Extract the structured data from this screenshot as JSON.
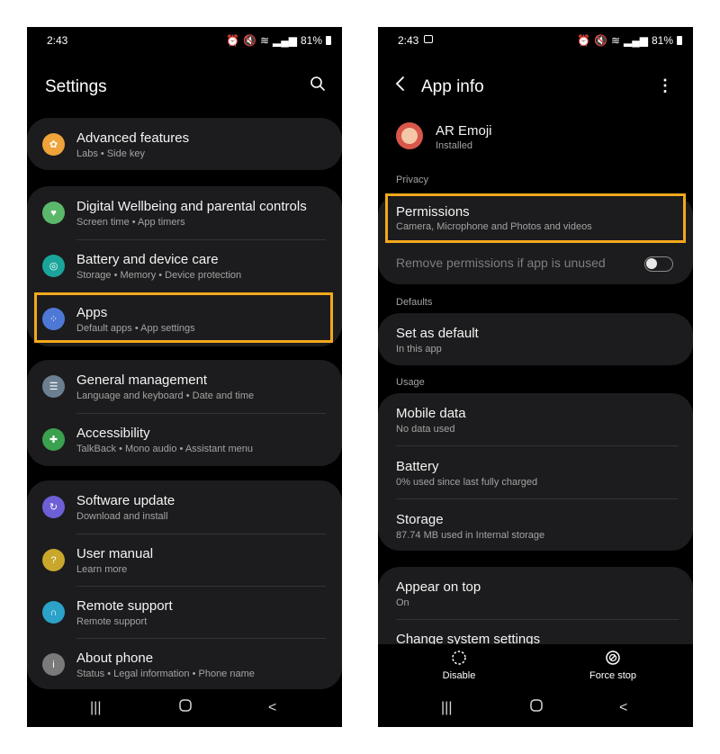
{
  "left": {
    "status_time": "2:43",
    "status_battery": "81%",
    "title": "Settings",
    "groups": [
      {
        "items": [
          {
            "label": "Advanced features",
            "sub": "Labs  •  Side key",
            "icon": "star-gear-icon",
            "color": "#eea33b"
          }
        ]
      },
      {
        "items": [
          {
            "label": "Digital Wellbeing and parental controls",
            "sub": "Screen time  •  App timers",
            "icon": "heart-circle-icon",
            "color": "#5bb86a"
          },
          {
            "label": "Battery and device care",
            "sub": "Storage  •  Memory  •  Device protection",
            "icon": "device-care-icon",
            "color": "#1ba59a"
          },
          {
            "label": "Apps",
            "sub": "Default apps  •  App settings",
            "icon": "apps-grid-icon",
            "color": "#4e78d6"
          }
        ]
      },
      {
        "items": [
          {
            "label": "General management",
            "sub": "Language and keyboard  •  Date and time",
            "icon": "sliders-icon",
            "color": "#6b7f90"
          },
          {
            "label": "Accessibility",
            "sub": "TalkBack  •  Mono audio  •  Assistant menu",
            "icon": "accessibility-person-icon",
            "color": "#3aa14f"
          }
        ]
      },
      {
        "items": [
          {
            "label": "Software update",
            "sub": "Download and install",
            "icon": "update-icon",
            "color": "#6d5fd6"
          },
          {
            "label": "User manual",
            "sub": "Learn more",
            "icon": "manual-icon",
            "color": "#c9a72a"
          },
          {
            "label": "Remote support",
            "sub": "Remote support",
            "icon": "headset-icon",
            "color": "#2ba2c8"
          },
          {
            "label": "About phone",
            "sub": "Status  •  Legal information  •  Phone name",
            "icon": "info-icon",
            "color": "#7a7a7a"
          }
        ]
      }
    ]
  },
  "right": {
    "status_time": "2:43",
    "status_battery": "81%",
    "title": "App info",
    "app_name": "AR Emoji",
    "app_status": "Installed",
    "privacy_label": "Privacy",
    "permissions_label": "Permissions",
    "permissions_sub": "Camera, Microphone and Photos and videos",
    "remove_perm_label": "Remove permissions if app is unused",
    "remove_perm_enabled": false,
    "defaults_label": "Defaults",
    "set_default_label": "Set as default",
    "set_default_sub": "In this app",
    "usage_label": "Usage",
    "mobile_data_label": "Mobile data",
    "mobile_data_sub": "No data used",
    "battery_label": "Battery",
    "battery_sub": "0% used since last fully charged",
    "storage_label": "Storage",
    "storage_sub": "87.74 MB used in Internal storage",
    "appear_top_label": "Appear on top",
    "appear_top_sub": "On",
    "change_sys_label": "Change system settings",
    "disable_label": "Disable",
    "force_stop_label": "Force stop"
  },
  "colors": {
    "highlight": "#f3a81c",
    "card_bg": "#1c1c1e",
    "screen_bg": "#000000"
  }
}
